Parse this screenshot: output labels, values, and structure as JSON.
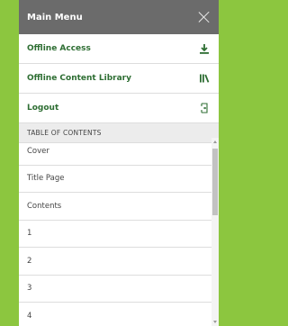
{
  "colors": {
    "background": "#8cc63f",
    "header_bg": "#6b6b6b",
    "menu_text": "#2e6e33",
    "toc_header_bg": "#ececec"
  },
  "header": {
    "title": "Main Menu",
    "close_icon": "close-icon"
  },
  "menu": {
    "items": [
      {
        "label": "Offline Access",
        "icon": "download-icon"
      },
      {
        "label": "Offline Content Library",
        "icon": "library-icon"
      },
      {
        "label": "Logout",
        "icon": "logout-icon"
      }
    ]
  },
  "toc": {
    "heading": "TABLE OF CONTENTS",
    "items": [
      "Cover",
      "Title Page",
      "Contents",
      "1",
      "2",
      "3",
      "4"
    ]
  }
}
